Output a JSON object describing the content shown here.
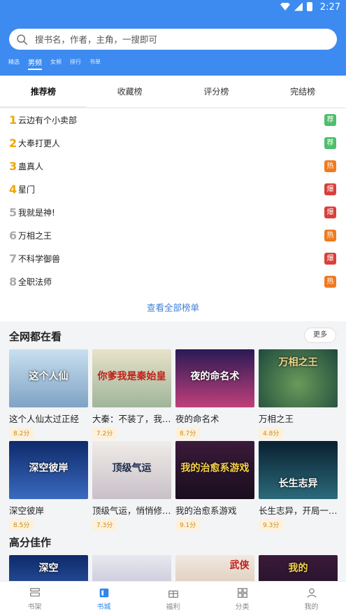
{
  "status": {
    "time": "2:27"
  },
  "search": {
    "placeholder": "搜书名，作者，主角，一搜即可"
  },
  "categories": [
    "精选",
    "男频",
    "女频",
    "排行",
    "书单"
  ],
  "rank_tabs": [
    "推荐榜",
    "收藏榜",
    "评分榜",
    "完结榜"
  ],
  "ranks": [
    {
      "num": "1",
      "name": "云边有个小卖部",
      "tag": "荐",
      "tag_type": "jian"
    },
    {
      "num": "2",
      "name": "大奉打更人",
      "tag": "荐",
      "tag_type": "jian"
    },
    {
      "num": "3",
      "name": "蛊真人",
      "tag": "热",
      "tag_type": "re"
    },
    {
      "num": "4",
      "name": "星门",
      "tag": "爆",
      "tag_type": "bao"
    },
    {
      "num": "5",
      "name": "我就是神!",
      "tag": "爆",
      "tag_type": "bao"
    },
    {
      "num": "6",
      "name": "万相之王",
      "tag": "热",
      "tag_type": "re"
    },
    {
      "num": "7",
      "name": "不科学御兽",
      "tag": "爆",
      "tag_type": "bao"
    },
    {
      "num": "8",
      "name": "全职法师",
      "tag": "热",
      "tag_type": "re"
    }
  ],
  "view_all": "查看全部榜单",
  "section1": {
    "title": "全网都在看",
    "more": "更多"
  },
  "books1": [
    {
      "title": "这个人仙太过正经",
      "score": "8.2分",
      "cover_text": "这个人仙",
      "color": "#b9d3e8"
    },
    {
      "title": "大秦：不装了，我是秦始皇",
      "score": "7.2分",
      "cover_text": "你爹我是秦始皇",
      "color": "#d8d2b8"
    },
    {
      "title": "夜的命名术",
      "score": "8.7分",
      "cover_text": "夜的命名术",
      "color": "#4a2a6a"
    },
    {
      "title": "万相之王",
      "score": "4.8分",
      "cover_text": "万相之王",
      "color": "#2d5a4a"
    },
    {
      "title": "深空彼岸",
      "score": "8.5分",
      "cover_text": "深空彼岸",
      "color": "#1a3a7a"
    },
    {
      "title": "顶级气运，悄悄修炼千年",
      "score": "7.3分",
      "cover_text": "顶级气运",
      "color": "#e8e0d8"
    },
    {
      "title": "我的治愈系游戏",
      "score": "9.1分",
      "cover_text": "我的治愈系游戏",
      "color": "#2a1a30"
    },
    {
      "title": "长生志异，开局一座城隍",
      "score": "9.3分",
      "cover_text": "长生志异",
      "color": "#0e2a3a"
    }
  ],
  "section2": {
    "title": "高分佳作"
  },
  "books2": [
    {
      "cover_text": "深空",
      "color": "#1a3a7a"
    },
    {
      "cover_text": "",
      "color": "#c8c8d8"
    },
    {
      "cover_text": "武侠",
      "color": "#e8d8c8"
    },
    {
      "cover_text": "我的",
      "color": "#2a1a30"
    }
  ],
  "nav": [
    "书架",
    "书城",
    "福利",
    "分类",
    "我的"
  ]
}
